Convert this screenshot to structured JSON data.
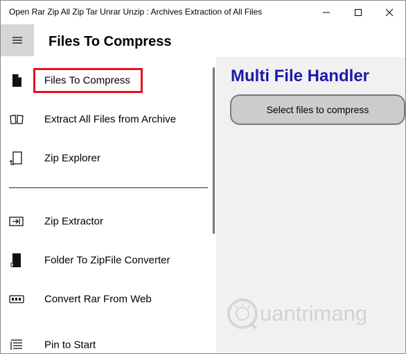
{
  "window": {
    "title": "Open Rar Zip All Zip Tar Unrar Unzip : Archives Extraction of All Files"
  },
  "header": {
    "page_title": "Files To Compress"
  },
  "nav": {
    "items": [
      {
        "label": "Files To Compress",
        "icon": "file-icon",
        "selected": true
      },
      {
        "label": "Extract All Files from  Archive",
        "icon": "open-book-icon"
      },
      {
        "label": "Zip Explorer",
        "icon": "zip-explorer-icon"
      },
      {
        "label": "Zip Extractor",
        "icon": "extract-icon"
      },
      {
        "label": "Folder To ZipFile Converter",
        "icon": "folder-file-icon"
      },
      {
        "label": "Convert Rar From Web",
        "icon": "web-convert-icon"
      },
      {
        "label": "Pin to Start",
        "icon": "pin-list-icon"
      }
    ]
  },
  "content": {
    "title": "Multi File Handler",
    "select_button": "Select files to compress"
  },
  "watermark": {
    "text": "uantrimang"
  },
  "colors": {
    "accent_title": "#1a1aa6",
    "selection_outline": "#e81123",
    "content_bg": "#f1f1f1",
    "hamburger_bg": "#d6d6d6"
  }
}
